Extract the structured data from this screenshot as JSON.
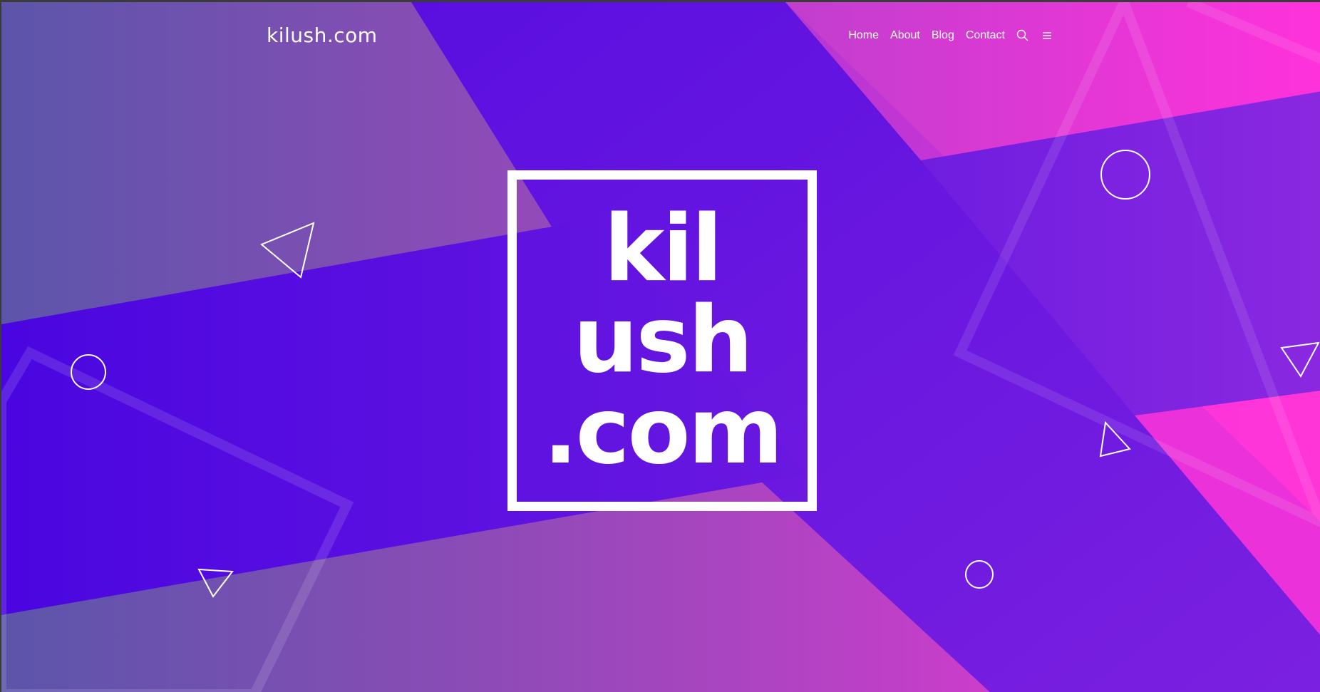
{
  "site": {
    "logo_text": "kilush.com"
  },
  "nav": {
    "items": [
      {
        "label": "Home"
      },
      {
        "label": "About"
      },
      {
        "label": "Blog"
      },
      {
        "label": "Contact"
      }
    ],
    "search_icon": "search-icon",
    "menu_icon": "hamburger-menu-icon"
  },
  "hero": {
    "lines": [
      "kil",
      "ush",
      ".com"
    ]
  },
  "colors": {
    "violet": "#5a10e0",
    "magenta": "#ff35d8",
    "slate_blue": "#5a57a8",
    "white": "#ffffff"
  }
}
